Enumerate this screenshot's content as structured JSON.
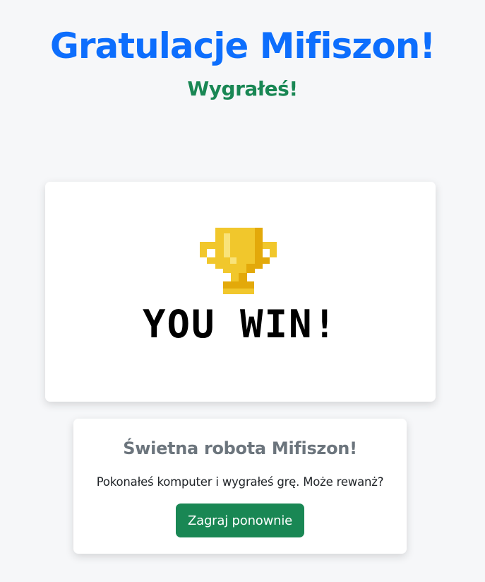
{
  "header": {
    "title": "Gratulacje Mifiszon!",
    "subtitle": "Wygrałeś!"
  },
  "banner": {
    "icon": "trophy-icon",
    "text": "YOU WIN!"
  },
  "info": {
    "heading": "Świetna robota Mifiszon!",
    "message": "Pokonałeś komputer i wygrałeś grę. Może rewanż?",
    "button_label": "Zagraj ponownie"
  },
  "colors": {
    "title": "#0d6efd",
    "subtitle": "#198754",
    "button": "#198754",
    "heading": "#6c757d",
    "background": "#f6f7f9",
    "trophy_gold": "#f1c72c",
    "trophy_shade": "#e3a90a",
    "trophy_light": "#f9e37a"
  }
}
